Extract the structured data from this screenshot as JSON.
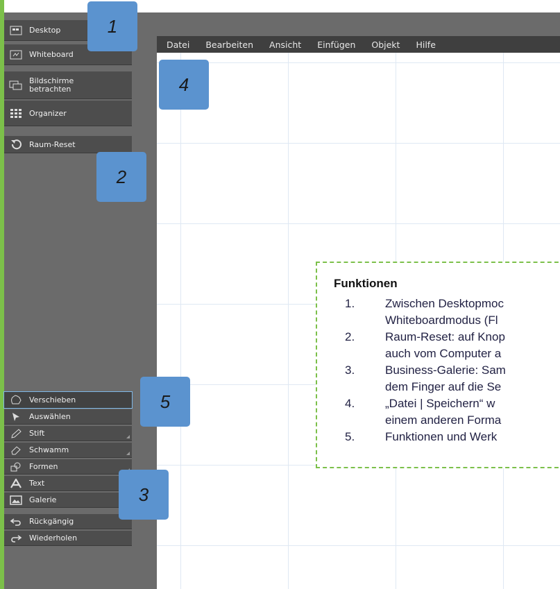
{
  "sidebar": {
    "top_items": [
      {
        "label": "Desktop",
        "icon": "desktop-icon"
      },
      {
        "label": "Whiteboard",
        "icon": "whiteboard-icon"
      },
      {
        "label": "Bildschirme\nbetrachten",
        "icon": "monitors-icon"
      },
      {
        "label": "Organizer",
        "icon": "grid-icon"
      }
    ],
    "reset": {
      "label": "Raum-Reset",
      "icon": "reset-icon"
    },
    "tools": [
      {
        "label": "Verschieben",
        "icon": "hand-icon",
        "selected": true
      },
      {
        "label": "Auswählen",
        "icon": "pointer-icon"
      },
      {
        "label": "Stift",
        "icon": "pen-icon"
      },
      {
        "label": "Schwamm",
        "icon": "eraser-icon"
      },
      {
        "label": "Formen",
        "icon": "shapes-icon"
      },
      {
        "label": "Text",
        "icon": "text-icon"
      },
      {
        "label": "Galerie",
        "icon": "gallery-icon"
      }
    ],
    "history": [
      {
        "label": "Rückgängig",
        "icon": "undo-icon"
      },
      {
        "label": "Wiederholen",
        "icon": "redo-icon"
      }
    ]
  },
  "menubar": [
    "Datei",
    "Bearbeiten",
    "Ansicht",
    "Einfügen",
    "Objekt",
    "Hilfe"
  ],
  "callouts": [
    "1",
    "2",
    "3",
    "4",
    "5"
  ],
  "funktionen": {
    "title": "Funktionen",
    "items": [
      {
        "num": "1.",
        "text": "Zwischen Desktopmoc\nWhiteboardmodus (Fl"
      },
      {
        "num": "2.",
        "text": "Raum-Reset: auf Knop\nauch vom Computer a"
      },
      {
        "num": "3.",
        "text": "Business-Galerie: Sam\ndem Finger auf die Se"
      },
      {
        "num": "4.",
        "text": "„Datei | Speichern“ w\neinem anderen Forma"
      },
      {
        "num": "5.",
        "text": "Funktionen und Werk"
      }
    ]
  },
  "colors": {
    "accent_green": "#7cc04a",
    "callout_blue": "#5b93cf",
    "sidebar": "#6b6b6b",
    "button": "#4d4d4d"
  }
}
